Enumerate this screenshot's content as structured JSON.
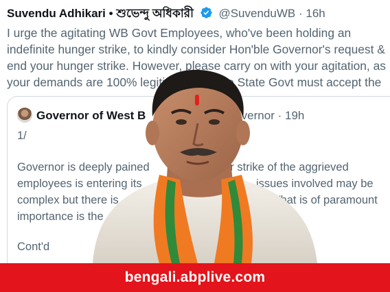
{
  "tweet": {
    "author_name": "Suvendu Adhikari",
    "separator": "•",
    "author_name_bengali": "শুভেন্দু অধিকারী",
    "handle": "@SuvenduWB",
    "dot": "·",
    "time": "16h",
    "lines": [
      "I urge the agitating WB Govt Employees, who've been holding an",
      "indefinite hunger strike, to kindly consider Hon'ble Governor's request &",
      "end your hunger strike. However, please carry on with your agitation, as",
      "your demands are 100% legiti",
      "d the State Govt must accept the"
    ]
  },
  "quote": {
    "author_name": "Governor of West B",
    "handle_partial": "Governor",
    "dot": "·",
    "time": "19h",
    "lines": [
      "1/",
      "Governor is deeply pained",
      "ger strike of the  aggrieved",
      "employees  is entering its",
      "issues involved  may be",
      "complex  but there is",
      "What is of paramount",
      "importance is the",
      "Cont'd"
    ]
  },
  "banner": {
    "text": "bengali.abplive.com"
  },
  "colors": {
    "banner": "#e3141b",
    "verified": "#1d9bf0",
    "muted": "#536471"
  },
  "icons": {
    "verified": "verified-badge-icon"
  }
}
